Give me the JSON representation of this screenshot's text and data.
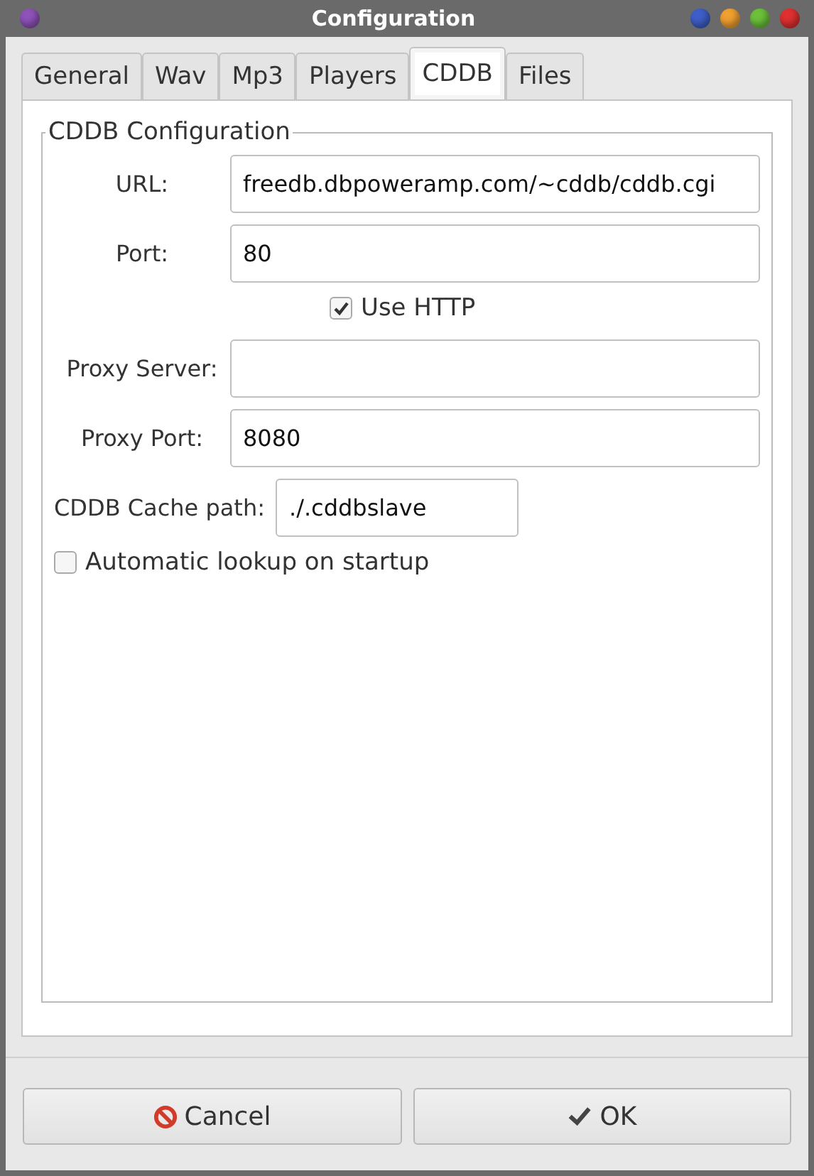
{
  "window": {
    "title": "Configuration",
    "controls": [
      {
        "color": "#3f5fc8"
      },
      {
        "color": "#f0a030"
      },
      {
        "color": "#6cc03a"
      },
      {
        "color": "#e03030"
      }
    ]
  },
  "tabs": [
    {
      "label": "General",
      "selected": false
    },
    {
      "label": "Wav",
      "selected": false
    },
    {
      "label": "Mp3",
      "selected": false
    },
    {
      "label": "Players",
      "selected": false
    },
    {
      "label": "CDDB",
      "selected": true
    },
    {
      "label": "Files",
      "selected": false
    }
  ],
  "group": {
    "title": "CDDB Configuration",
    "rows": [
      {
        "kind": "field",
        "label": "URL:",
        "value": "freedb.dbpoweramp.com/~cddb/cddb.cgi"
      },
      {
        "kind": "field",
        "label": "Port:",
        "value": "80"
      },
      {
        "kind": "check",
        "label": "Use HTTP",
        "checked": true
      },
      {
        "kind": "field",
        "label": "Proxy Server:",
        "value": ""
      },
      {
        "kind": "field",
        "label": "Proxy Port:",
        "value": "8080"
      },
      {
        "kind": "short",
        "label": "CDDB Cache path:",
        "value": "./.cddbslave"
      },
      {
        "kind": "lcheck",
        "label": "Automatic lookup on startup",
        "checked": false
      }
    ]
  },
  "buttons": [
    {
      "kind": "cancel",
      "label": "Cancel"
    },
    {
      "kind": "ok",
      "label": "OK"
    }
  ]
}
